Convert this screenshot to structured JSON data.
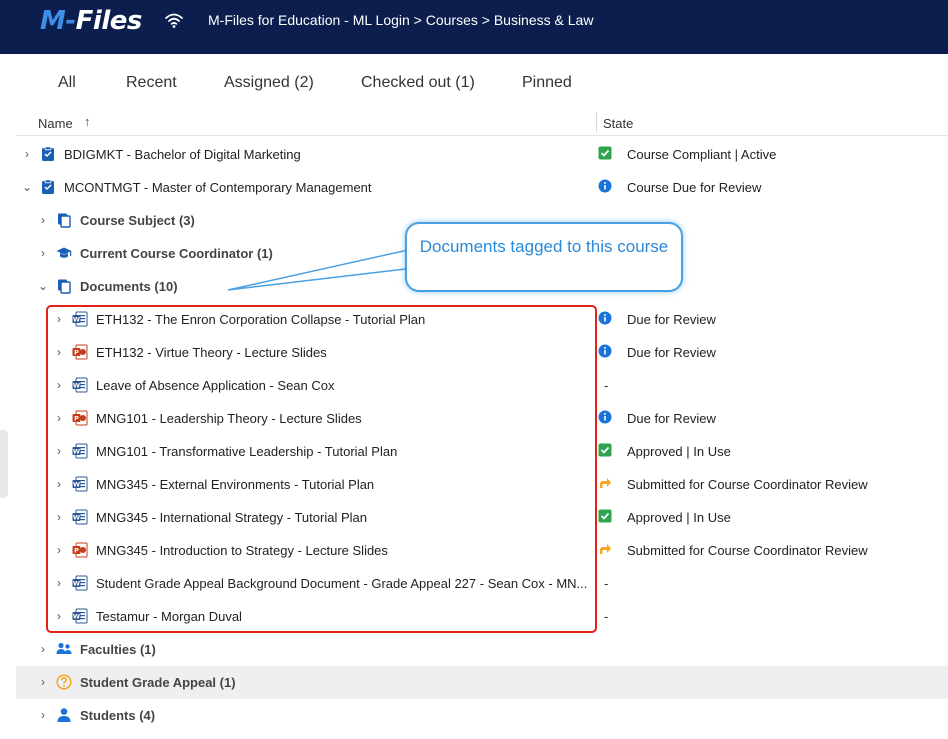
{
  "app": {
    "logo_m": "M-",
    "logo_rest": "Files",
    "breadcrumb": "M-Files for Education - ML Login > Courses > Business & Law"
  },
  "tabs": [
    "All",
    "Recent",
    "Assigned (2)",
    "Checked out (1)",
    "Pinned"
  ],
  "columns": {
    "name": "Name",
    "sort_icon": "arrow-up-icon",
    "state": "State"
  },
  "rows": [
    {
      "label": "BDIGMKT - Bachelor of Digital Marketing",
      "icon": "course-icon",
      "chevron": "right",
      "state": "Course Compliant | Active",
      "state_icon": "check-icon"
    },
    {
      "label": "MCONTMGT - Master of Contemporary Management",
      "icon": "course-icon",
      "chevron": "down",
      "state": "Course Due for Review",
      "state_icon": "info-icon"
    },
    {
      "label": "Course Subject (3)",
      "icon": "copy-icon",
      "chevron": "right"
    },
    {
      "label": "Current Course Coordinator (1)",
      "icon": "graduation-cap-icon",
      "chevron": "right"
    },
    {
      "label": "Documents (10)",
      "icon": "copy-icon",
      "chevron": "down"
    },
    {
      "label": "ETH132 - The Enron Corporation Collapse - Tutorial Plan",
      "icon": "word-icon",
      "chevron": "right",
      "state": "Due for Review",
      "state_icon": "info-icon"
    },
    {
      "label": "ETH132 - Virtue Theory - Lecture Slides",
      "icon": "powerpoint-icon",
      "chevron": "right",
      "state": "Due for Review",
      "state_icon": "info-icon"
    },
    {
      "label": "Leave of Absence Application - Sean Cox",
      "icon": "word-icon",
      "chevron": "right",
      "state": "-"
    },
    {
      "label": "MNG101 - Leadership Theory - Lecture Slides",
      "icon": "powerpoint-icon",
      "chevron": "right",
      "state": "Due for Review",
      "state_icon": "info-icon"
    },
    {
      "label": "MNG101 - Transformative Leadership - Tutorial Plan",
      "icon": "word-icon",
      "chevron": "right",
      "state": "Approved | In Use",
      "state_icon": "check-icon"
    },
    {
      "label": "MNG345 - External Environments - Tutorial Plan",
      "icon": "word-icon",
      "chevron": "right",
      "state": "Submitted for Course Coordinator Review",
      "state_icon": "forward-arrow-icon"
    },
    {
      "label": "MNG345 - International Strategy - Tutorial Plan",
      "icon": "word-icon",
      "chevron": "right",
      "state": "Approved | In Use",
      "state_icon": "check-icon"
    },
    {
      "label": "MNG345 - Introduction to Strategy - Lecture Slides",
      "icon": "powerpoint-icon",
      "chevron": "right",
      "state": "Submitted for Course Coordinator Review",
      "state_icon": "forward-arrow-icon"
    },
    {
      "label": "Student Grade Appeal Background Document - Grade Appeal 227 - Sean Cox - MN...",
      "icon": "word-icon",
      "chevron": "right",
      "state": "-"
    },
    {
      "label": "Testamur - Morgan Duval",
      "icon": "word-icon",
      "chevron": "right",
      "state": "-"
    },
    {
      "label": "Faculties (1)",
      "icon": "people-icon",
      "chevron": "right"
    },
    {
      "label": "Student Grade Appeal (1)",
      "icon": "question-circle-icon",
      "chevron": "right"
    },
    {
      "label": "Students (4)",
      "icon": "person-icon",
      "chevron": "right"
    }
  ],
  "annotation": {
    "text": "Documents tagged to this course"
  },
  "colors": {
    "topbar": "#0c1e4d",
    "brand_blue": "#3d8ee8",
    "callout_blue": "#2a8ad8",
    "highlight_red": "#e2231a",
    "check_green": "#2ea44f",
    "info_blue": "#1a73d9",
    "arrow_orange": "#f5a623"
  }
}
